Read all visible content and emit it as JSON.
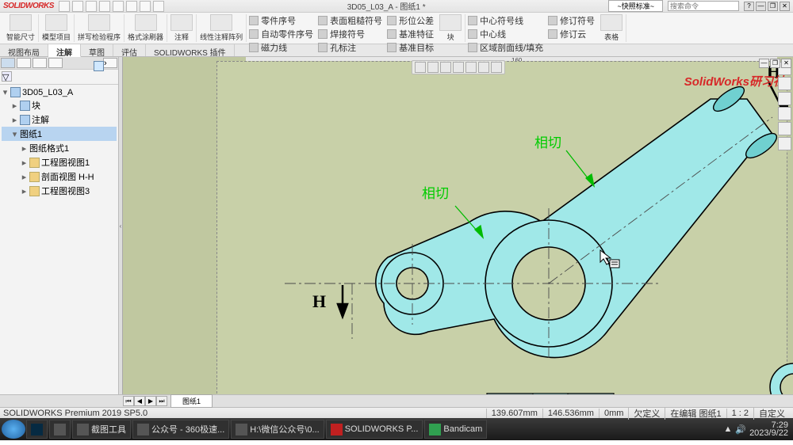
{
  "app": {
    "logo": "SOLIDWORKS",
    "title": "3D05_L03_A - 图纸1 *",
    "search_ph": "搜索命令",
    "display_state": "~快照标准~"
  },
  "win": {
    "min": "—",
    "max": "❐",
    "close": "✕",
    "help": "?"
  },
  "ribbon": {
    "big": [
      {
        "lbl": "智能尺寸"
      },
      {
        "lbl": "模型项目"
      },
      {
        "lbl": "拼写检验程序"
      },
      {
        "lbl": "格式涂刷器"
      },
      {
        "lbl": "注释"
      }
    ],
    "col1": [
      {
        "lbl": "线性注释阵列"
      }
    ],
    "col2": [
      {
        "lbl": "零件序号"
      },
      {
        "lbl": "自动零件序号"
      },
      {
        "lbl": "磁力线"
      }
    ],
    "col3": [
      {
        "lbl": "表面粗糙符号"
      },
      {
        "lbl": "焊接符号"
      },
      {
        "lbl": "孔标注"
      }
    ],
    "col4": [
      {
        "lbl": "形位公差"
      },
      {
        "lbl": "基准特征"
      },
      {
        "lbl": "基准目标"
      }
    ],
    "col5": [
      {
        "lbl": "块"
      }
    ],
    "col6": [
      {
        "lbl": "中心符号线"
      },
      {
        "lbl": "中心线"
      },
      {
        "lbl": "区域剖面线/填充"
      }
    ],
    "col7": [
      {
        "lbl": "修订符号"
      },
      {
        "lbl": "修订云"
      }
    ],
    "col8": [
      {
        "lbl": "表格"
      }
    ]
  },
  "tabs": {
    "items": [
      "视图布局",
      "注解",
      "草图",
      "评估",
      "SOLIDWORKS 插件"
    ],
    "active": 1
  },
  "tree": {
    "root": "3D05_L03_A",
    "items": [
      {
        "lvl": 2,
        "ic": "doc",
        "lbl": "块",
        "exp": "▸"
      },
      {
        "lvl": 2,
        "ic": "doc",
        "lbl": "注解",
        "exp": "▸"
      },
      {
        "lvl": 2,
        "ic": "sheet",
        "lbl": "图纸1",
        "exp": "▾",
        "sel": true
      },
      {
        "lvl": 3,
        "ic": "doc",
        "lbl": "图纸格式1",
        "exp": "▸"
      },
      {
        "lvl": 3,
        "ic": "view",
        "lbl": "工程图视图1",
        "exp": "▸"
      },
      {
        "lvl": 3,
        "ic": "view",
        "lbl": "剖面视图 H-H",
        "exp": "▸"
      },
      {
        "lvl": 3,
        "ic": "view",
        "lbl": "工程图视图3",
        "exp": "▸"
      }
    ]
  },
  "ruler": {
    "mark": "160"
  },
  "drawing": {
    "tangent1": "相切",
    "tangent2": "相切",
    "section_H_top": "H",
    "section_H_left": "H"
  },
  "watermark": "SolidWorks研习社",
  "sheettab": {
    "name": "图纸1"
  },
  "status": {
    "ver": "SOLIDWORKS Premium 2019 SP5.0",
    "x": "139.607mm",
    "y": "146.536mm",
    "z": "0mm",
    "mode": "欠定义",
    "ctx": "在编辑 图纸1",
    "zoom": "1 : 2",
    "custom": "自定义"
  },
  "taskbar": {
    "items": [
      {
        "cls": "ps",
        "lbl": ""
      },
      {
        "cls": "",
        "lbl": "截图工具"
      },
      {
        "cls": "",
        "lbl": "公众号 - 360极速..."
      },
      {
        "cls": "",
        "lbl": "H:\\微信公众号\\0..."
      },
      {
        "cls": "sw",
        "lbl": "SOLIDWORKS P..."
      },
      {
        "cls": "bc",
        "lbl": "Bandicam"
      }
    ],
    "time": "7:29",
    "date": "2023/9/22"
  }
}
